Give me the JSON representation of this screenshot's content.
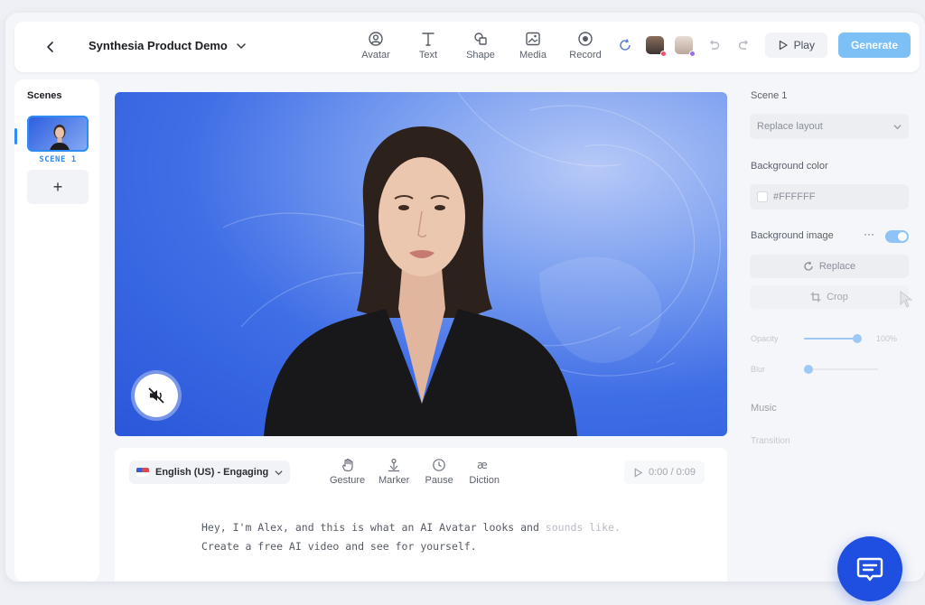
{
  "topbar": {
    "project_title": "Synthesia Product Demo",
    "tools": [
      {
        "label": "Avatar",
        "icon": "avatar-icon"
      },
      {
        "label": "Text",
        "icon": "text-icon"
      },
      {
        "label": "Shape",
        "icon": "shape-icon"
      },
      {
        "label": "Media",
        "icon": "media-icon"
      },
      {
        "label": "Record",
        "icon": "record-icon"
      }
    ],
    "play_label": "Play",
    "generate_label": "Generate"
  },
  "scenes": {
    "title": "Scenes",
    "items": [
      {
        "label": "SCENE 1"
      }
    ],
    "add_label": "+"
  },
  "script": {
    "language": "English (US) - Engaging",
    "tools": [
      {
        "label": "Gesture",
        "icon": "gesture-icon"
      },
      {
        "label": "Marker",
        "icon": "marker-icon"
      },
      {
        "label": "Pause",
        "icon": "clock-icon"
      },
      {
        "label": "Diction",
        "icon": "diction-icon"
      }
    ],
    "timer": "0:00 / 0:09",
    "line1_a": "Hey, I'm Alex, and this is what an AI Avatar looks and",
    "line1_b": " sounds like.",
    "line2": "Create a free AI video and see for yourself."
  },
  "properties": {
    "scene_title": "Scene 1",
    "layout_select": "Replace layout",
    "bg_color_label": "Background color",
    "bg_color_value": "#FFFFFF",
    "bg_image_label": "Background image",
    "bg_image_more": "···",
    "bg_image_enabled": true,
    "replace_label": "Replace",
    "crop_label": "Crop",
    "opacity_label": "Opacity",
    "opacity_value": "100%",
    "blur_label": "Blur",
    "music_label": "Music",
    "transition_label": "Transition"
  },
  "colors": {
    "accent": "#2f8cf5",
    "generate": "#7cc0f5",
    "chat": "#1f4fe0"
  }
}
